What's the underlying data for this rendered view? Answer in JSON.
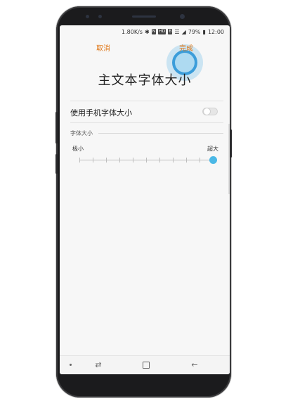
{
  "status_bar": {
    "speed": "1.80K/s",
    "badge_n": "N",
    "badge_hd": "HD",
    "badge_b": "B",
    "battery": "79%",
    "time": "12:00"
  },
  "app_bar": {
    "cancel_label": "取消",
    "done_label": "完成"
  },
  "page": {
    "title": "主文本字体大小"
  },
  "settings": {
    "use_phone_font_size_label": "使用手机字体大小",
    "use_phone_font_size_on": false,
    "section_label": "字体大小",
    "slider_min_label": "极小",
    "slider_max_label": "超大",
    "slider_steps": 11,
    "slider_value_fraction": 1.0
  },
  "nav_bar": {
    "recents_icon": "recents-icon",
    "home_icon": "home-icon",
    "back_icon": "back-icon"
  },
  "colors": {
    "accent_orange": "#e07a1d",
    "slider_blue": "#4bb8e6",
    "tap_highlight": "#2f96d7"
  }
}
